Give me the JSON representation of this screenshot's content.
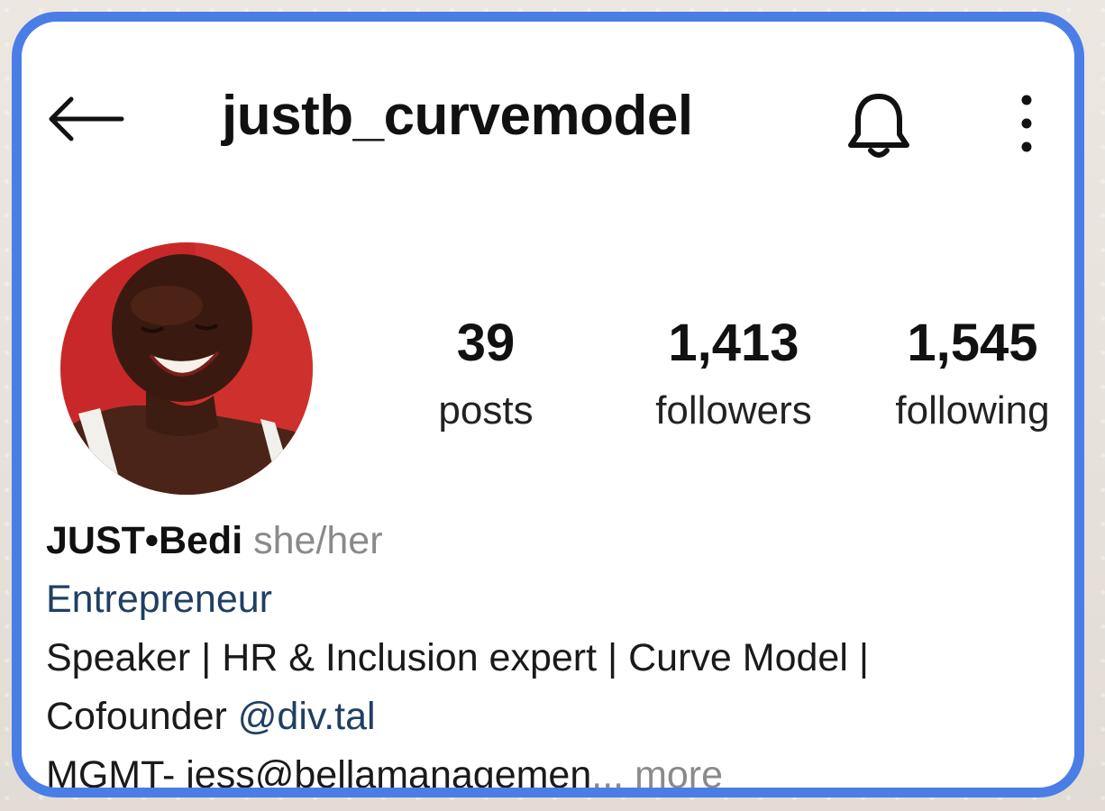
{
  "header": {
    "username": "justb_curvemodel",
    "back_icon": "arrow-left-icon",
    "notifications_icon": "bell-icon",
    "menu_icon": "more-vertical-icon"
  },
  "profile": {
    "stats": {
      "posts": {
        "value": "39",
        "label": "posts"
      },
      "followers": {
        "value": "1,413",
        "label": "followers"
      },
      "following": {
        "value": "1,545",
        "label": "following"
      }
    },
    "display_name": "JUST•Bedi",
    "pronouns": "she/her",
    "category": "Entrepreneur",
    "bio_line1": "Speaker | HR & Inclusion expert | Curve Model |",
    "bio_line2_text": "Cofounder ",
    "bio_line2_mention": "@div.tal",
    "bio_line3_text": "MGMT- jess@bellamanagemen",
    "bio_line3_ellipsis": "... ",
    "bio_more": "more"
  },
  "colors": {
    "frame_border": "#4a7ee6",
    "link": "#1f3f63",
    "muted": "#8a8a8a",
    "avatar_background": "#c8282a"
  }
}
